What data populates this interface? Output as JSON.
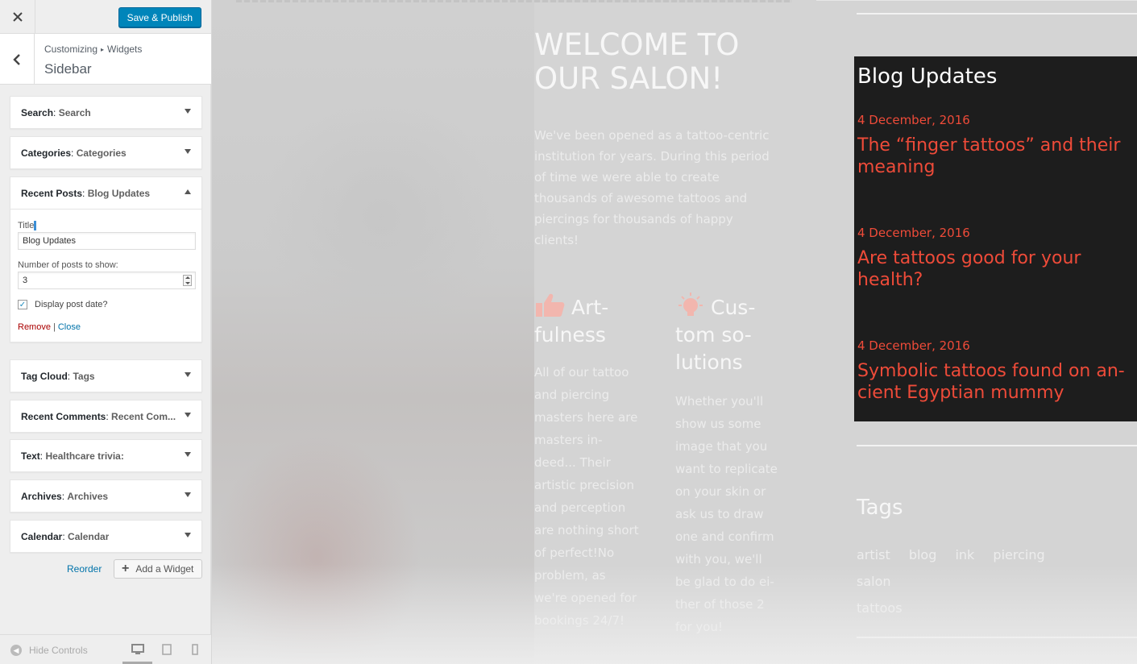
{
  "panel": {
    "close_icon": "close-icon",
    "save_label": "Save & Publish",
    "breadcrumb": {
      "root": "Customizing",
      "current": "Widgets"
    },
    "section_title": "Sidebar"
  },
  "widgets": [
    {
      "type": "Search",
      "title": "Search"
    },
    {
      "type": "Categories",
      "title": "Categories"
    },
    {
      "type": "Recent Posts",
      "title": "Blog Updates"
    },
    {
      "type": "Tag Cloud",
      "title": "Tags"
    },
    {
      "type": "Recent Comments",
      "title": "Recent Com..."
    },
    {
      "type": "Text",
      "title": "Healthcare trivia:"
    },
    {
      "type": "Archives",
      "title": "Archives"
    },
    {
      "type": "Calendar",
      "title": "Calendar"
    }
  ],
  "form": {
    "title_label": "Title",
    "title_value": "Blog Updates",
    "num_label": "Number of posts to show:",
    "num_value": "3",
    "date_label": "Display post date?",
    "date_checked": true,
    "remove": "Remove",
    "sep": "|",
    "close": "Close"
  },
  "bottom": {
    "reorder": "Reorder",
    "add_widget": "Add a Widget",
    "hide_controls": "Hide Controls"
  },
  "preview": {
    "welcome": "WELCOME TO OUR SALON!",
    "intro": "We've been opened as a tattoo-centric institution for years. During this period of time we were able to create thousands of awesome tattoos and piercings for thousands of happy clients!",
    "feature1": {
      "title": "Art­fulness",
      "text": "All of our tattoo and piercing masters here are masters in­deed... Their artistic preci­sion and per­ception are nothing short of perfect!No problem, as we're opened for bookings 24/7!"
    },
    "feature2": {
      "title": "Cus­tom so­lutions",
      "text": "Whether you'll show us some image that you want to repli­cate on your skin or ask us to draw one and confirm with you, we'll be glad to do ei­ther of those 2 for you!"
    },
    "blog": {
      "title": "Blog Updates",
      "posts": [
        {
          "date": "4 December, 2016",
          "title": "The “finger tattoos” and their meaning"
        },
        {
          "date": "4 December, 2016",
          "title": "Are tattoos good for your health?"
        },
        {
          "date": "4 December, 2016",
          "title": "Symbolic tattoos found on an­cient Egyptian mummy"
        }
      ]
    },
    "tags_title": "Tags",
    "tags": [
      "artist",
      "blog",
      "ink",
      "piercing",
      "salon",
      "tattoos"
    ]
  },
  "colors": {
    "accent": "#0085ba",
    "post_red": "#ee4b39",
    "blog_bg": "#1d1d1d"
  }
}
